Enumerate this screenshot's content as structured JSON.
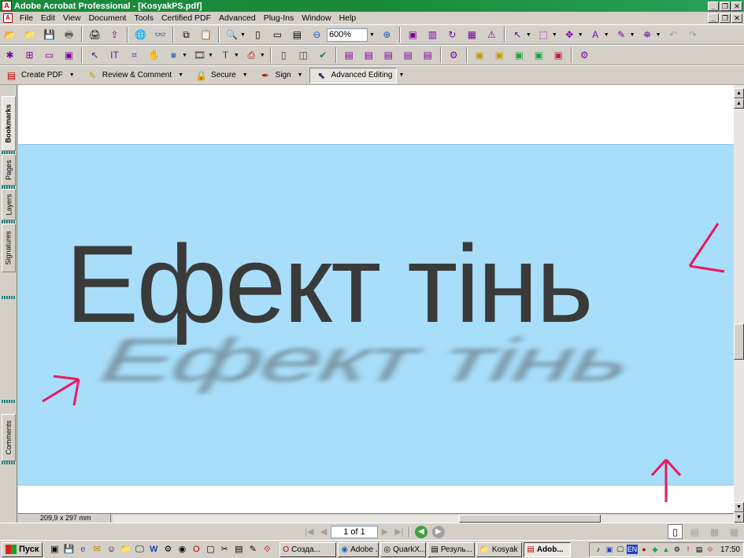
{
  "window": {
    "title": "Adobe Acrobat Professional - [KosyakPS.pdf]",
    "app_icon": "acrobat-icon",
    "controls": [
      "_",
      "❐",
      "✕"
    ]
  },
  "menu": {
    "items": [
      "File",
      "Edit",
      "View",
      "Document",
      "Tools",
      "Certified PDF",
      "Advanced",
      "Plug-Ins",
      "Window",
      "Help"
    ],
    "doc_controls": [
      "_",
      "❐",
      "✕"
    ]
  },
  "toolbar": {
    "zoom_value": "600%"
  },
  "tasks": {
    "create_pdf": "Create PDF",
    "review_comment": "Review & Comment",
    "secure": "Secure",
    "sign": "Sign",
    "advanced_editing": "Advanced Editing"
  },
  "navtabs": [
    "Bookmarks",
    "Pages",
    "Layers",
    "Signatures",
    "Comments"
  ],
  "document": {
    "headline": "Ефект тінь",
    "band_color": "#a8def9",
    "arrow_color": "#e8195f"
  },
  "status": {
    "page_size": "209,9 x 297 mm",
    "page_indicator": "1 of 1"
  },
  "taskbar": {
    "start_label": "Пуск",
    "tasks": [
      "Созда...",
      "Adobe ...",
      "QuarkX...",
      "Резуль...",
      "Kosyak",
      "Adob..."
    ],
    "active_task": "Adob...",
    "tray_lang": "EN",
    "clock": "17:50"
  }
}
